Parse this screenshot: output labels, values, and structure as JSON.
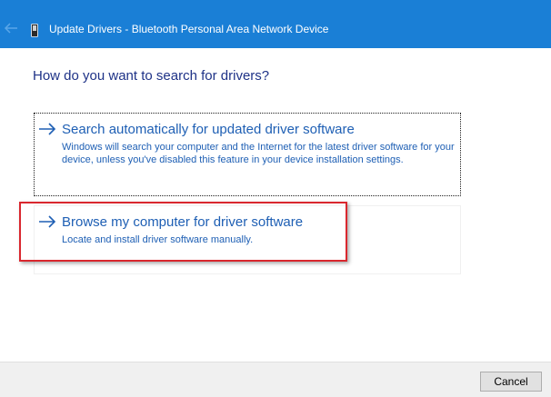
{
  "titlebar": {
    "title": "Update Drivers - Bluetooth Personal Area Network Device",
    "back_icon": "back-arrow-icon",
    "device_icon": "device-icon",
    "background_color": "#1a7fd6"
  },
  "main": {
    "question": "How do you want to search for drivers?",
    "options": [
      {
        "title": "Search automatically for updated driver software",
        "description": "Windows will search your computer and the Internet for the latest driver software for your device, unless you've disabled this feature in your device installation settings.",
        "icon": "right-arrow-icon",
        "focused": true
      },
      {
        "title": "Browse my computer for driver software",
        "description": "Locate and install driver software manually.",
        "icon": "right-arrow-icon",
        "highlighted": true
      }
    ]
  },
  "footer": {
    "cancel_label": "Cancel"
  },
  "colors": {
    "link_blue": "#1e5fb4",
    "heading_blue": "#1e3287",
    "highlight_red": "#d9272e"
  }
}
